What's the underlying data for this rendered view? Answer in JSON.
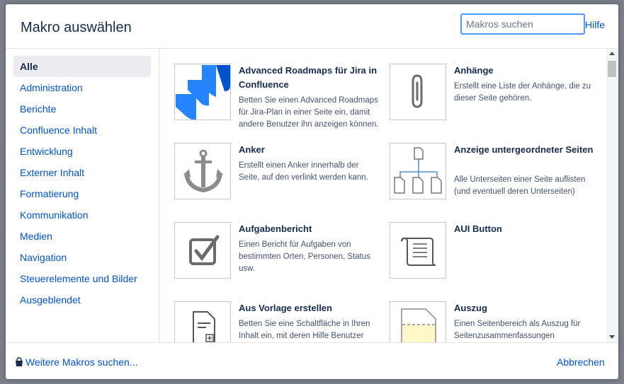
{
  "dialog": {
    "title": "Makro auswählen",
    "search_placeholder": "Makros suchen",
    "help_label": "Hilfe"
  },
  "sidebar": {
    "items": [
      {
        "label": "Alle",
        "active": true
      },
      {
        "label": "Administration"
      },
      {
        "label": "Berichte"
      },
      {
        "label": "Confluence Inhalt"
      },
      {
        "label": "Entwicklung"
      },
      {
        "label": "Externer Inhalt"
      },
      {
        "label": "Formatierung"
      },
      {
        "label": "Kommunikation"
      },
      {
        "label": "Medien"
      },
      {
        "label": "Navigation"
      },
      {
        "label": "Steuerelemente und Bilder"
      },
      {
        "label": "Ausgeblendet"
      }
    ]
  },
  "macros": [
    {
      "name": "Advanced Roadmaps für Jira in Confluence",
      "icon": "jira-logo-icon",
      "description": "Betten Sie einen Advanced Roadmaps für Jira-Plan in einer Seite ein, damit andere Benutzer ihn anzeigen können."
    },
    {
      "name": "Anhänge",
      "icon": "paperclip-icon",
      "description": "Erstellt eine Liste der Anhänge, die zu dieser Seite gehören."
    },
    {
      "name": "Anker",
      "icon": "anchor-icon",
      "description": "Erstellt einen Anker innerhalb der Seite, auf den verlinkt werden kann."
    },
    {
      "name": "Anzeige untergeordneter Seiten",
      "icon": "page-tree-icon",
      "description": "Alle Unterseiten einer Seite auflisten (und eventuell deren Unterseiten)"
    },
    {
      "name": "Aufgabenbericht",
      "icon": "checkbox-icon",
      "description": "Einen Bericht für Aufgaben von bestimmten Orten, Personen, Status usw."
    },
    {
      "name": "AUI Button",
      "icon": "scroll-icon",
      "description": ""
    },
    {
      "name": "Aus Vorlage erstellen",
      "icon": "template-icon",
      "description": "Betten Sie eine Schaltfläche in Ihren Inhalt ein, mit deren Hilfe Benutzer"
    },
    {
      "name": "Auszug",
      "icon": "excerpt-icon",
      "description": "Einen Seitenbereich als Auszug für Seitenzusammenfassungen"
    }
  ],
  "colors": {
    "link": "#0052cc",
    "text": "#172b4d",
    "jira_blue": "#2684ff",
    "search_focus": "#4c9aff",
    "icon_gray": "#6b6b6b"
  },
  "footer": {
    "more_macros_label": "Weitere Makros suchen...",
    "cancel_label": "Abbrechen"
  }
}
